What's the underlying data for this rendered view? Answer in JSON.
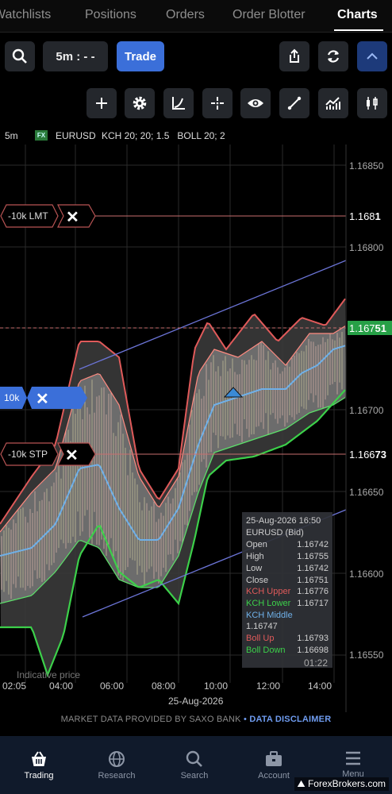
{
  "tabs": [
    "Watchlists",
    "Positions",
    "Orders",
    "Order Blotter",
    "Charts"
  ],
  "active_tab": "Charts",
  "toolbar": {
    "timeframe_label": "5m : - -",
    "trade_label": "Trade"
  },
  "chart_info": {
    "interval": "5m",
    "instrument_badge": "FX",
    "symbol": "EURUSD",
    "indicators": "KCH 20; 20; 1.5   BOLL 20; 2"
  },
  "price_axis": [
    "1.16850",
    "1.16800",
    "1.16750",
    "1.16700",
    "1.16650",
    "1.16600",
    "1.16550"
  ],
  "price_tags": {
    "lmt": {
      "prefix": "1.168",
      "suffix": "1"
    },
    "current": {
      "prefix": "1.167",
      "suffix": "51"
    },
    "stp": {
      "prefix": "1.166",
      "suffix": "73"
    }
  },
  "orders": {
    "lmt_label": "-10k LMT",
    "stp_label": "-10k STP",
    "position_label": "10k",
    "close_glyph": "✕"
  },
  "time_axis": [
    "02:05",
    "04:00",
    "06:00",
    "08:00",
    "10:00",
    "12:00",
    "14:00"
  ],
  "date_label": "25-Aug-2026",
  "watermark": "Indicative price",
  "countdown": "01:22",
  "tooltip": {
    "datetime": "25-Aug-2026 16:50",
    "instrument": "EURUSD (Bid)",
    "rows": [
      {
        "label": "Open",
        "value": "1.16742",
        "color": "#cfcfcf"
      },
      {
        "label": "High",
        "value": "1.16755",
        "color": "#cfcfcf"
      },
      {
        "label": "Low",
        "value": "1.16742",
        "color": "#cfcfcf"
      },
      {
        "label": "Close",
        "value": "1.16751",
        "color": "#cfcfcf"
      },
      {
        "label": "KCH Upper",
        "value": "1.16776",
        "color": "#e05a5a"
      },
      {
        "label": "KCH Lower",
        "value": "1.16717",
        "color": "#3cd04a"
      },
      {
        "label": "KCH Middle",
        "value": "",
        "color": "#6fb0e8"
      },
      {
        "label": "",
        "value": "1.16747",
        "color": "#cfcfcf"
      },
      {
        "label": "Boll Up",
        "value": "1.16793",
        "color": "#e05a5a"
      },
      {
        "label": "Boll Down",
        "value": "1.16698",
        "color": "#3cd04a"
      }
    ]
  },
  "disclaimer": {
    "text": "MARKET DATA PROVIDED BY SAXO BANK",
    "separator": "•",
    "link": "DATA DISCLAIMER"
  },
  "nav": [
    "Trading",
    "Research",
    "Search",
    "Account",
    "Menu"
  ],
  "brand": "ForexBrokers.com",
  "colors": {
    "accent": "#3b6fd9",
    "kch_upper": "#e05a5a",
    "kch_lower": "#3cd04a",
    "kch_middle": "#6fb0e8",
    "current_price": "#27a047"
  }
}
